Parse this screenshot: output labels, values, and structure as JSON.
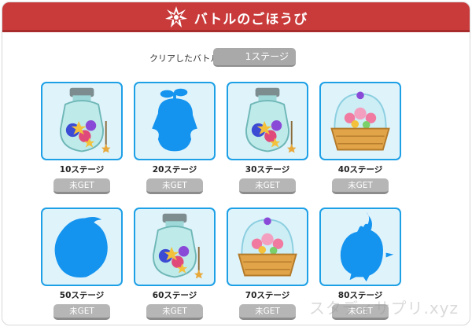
{
  "header": {
    "title": "バトルのごほうび",
    "bg_color": "#c93a3a",
    "icon": "burst-star-icon"
  },
  "cleared": {
    "label": "クリアしたバトル",
    "value": "1ステージ"
  },
  "rewards": [
    {
      "stage": "10ステージ",
      "button": "未GET",
      "kind": "jar-icon"
    },
    {
      "stage": "20ステージ",
      "button": "未GET",
      "kind": "sprout-silhouette-icon"
    },
    {
      "stage": "30ステージ",
      "button": "未GET",
      "kind": "jar-icon"
    },
    {
      "stage": "40ステージ",
      "button": "未GET",
      "kind": "candy-dome-icon"
    },
    {
      "stage": "50ステージ",
      "button": "未GET",
      "kind": "round-silhouette-icon"
    },
    {
      "stage": "60ステージ",
      "button": "未GET",
      "kind": "jar-icon"
    },
    {
      "stage": "70ステージ",
      "button": "未GET",
      "kind": "candy-dome-icon"
    },
    {
      "stage": "80ステージ",
      "button": "未GET",
      "kind": "bird-silhouette-icon"
    }
  ],
  "colors": {
    "card_border": "#1ea0e6",
    "card_bg": "#dff3fb",
    "silhouette": "#1494ef",
    "button": "#b6b6b6"
  },
  "watermark": "スタディサプリ.xyz"
}
